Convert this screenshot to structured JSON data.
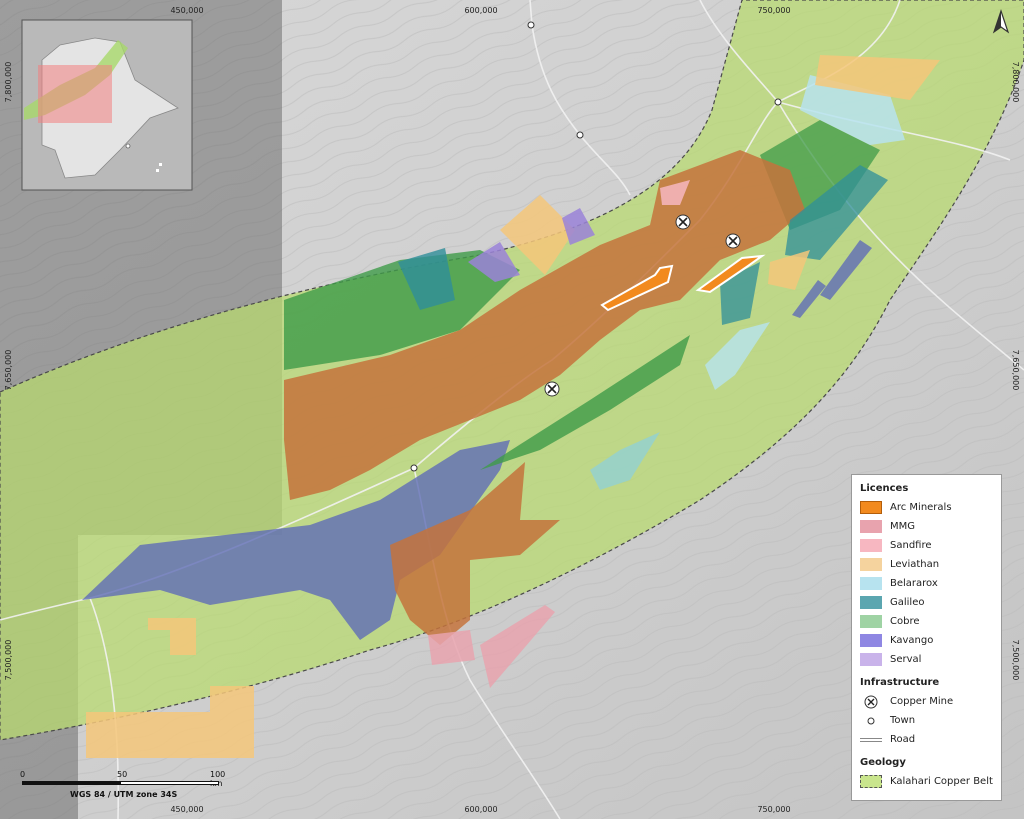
{
  "coords": {
    "top": [
      "450,000",
      "600,000",
      "750,000"
    ],
    "bottom": [
      "450,000",
      "600,000",
      "750,000"
    ],
    "left": [
      "7,800,000",
      "7,650,000",
      "7,500,000"
    ],
    "right": [
      "7,800,000",
      "7,650,000",
      "7,500,000"
    ]
  },
  "legend": {
    "licences_title": "Licences",
    "licences": [
      {
        "label": "Arc Minerals",
        "color": "#f28a1e"
      },
      {
        "label": "MMG",
        "color": "#e8a3ae"
      },
      {
        "label": "Sandfire",
        "color": "#f7b7c1"
      },
      {
        "label": "Leviathan",
        "color": "#f5d39e"
      },
      {
        "label": "Belararox",
        "color": "#b7e3ef"
      },
      {
        "label": "Galileo",
        "color": "#5ba6b0"
      },
      {
        "label": "Cobre",
        "color": "#9fd3a4"
      },
      {
        "label": "Kavango",
        "color": "#8f87e3"
      },
      {
        "label": "Serval",
        "color": "#c9b3ea"
      }
    ],
    "infrastructure_title": "Infrastructure",
    "infrastructure": [
      {
        "label": "Copper Mine",
        "icon": "copper-mine-icon"
      },
      {
        "label": "Town",
        "icon": "town-icon"
      },
      {
        "label": "Road",
        "icon": "road-icon"
      }
    ],
    "geology_title": "Geology",
    "geology": [
      {
        "label": "Kalahari Copper Belt",
        "color": "#c9e58d"
      }
    ]
  },
  "scale": {
    "ticks": [
      "0",
      "50",
      "100 km"
    ],
    "projection": "WGS 84 / UTM zone 34S"
  },
  "north_arrow": {
    "icon": "north-arrow-icon"
  },
  "colors": {
    "belt": "#b8db6e",
    "arc": "#f28a1e",
    "orange_licence": "#c4733c",
    "green_licence": "#3f9b48",
    "blue_licence": "#5f6db6"
  }
}
